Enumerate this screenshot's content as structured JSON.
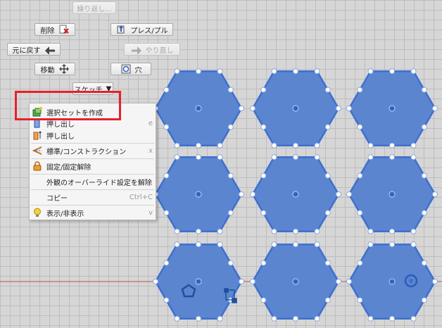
{
  "marking_menu": {
    "repeat": "繰り返し...",
    "delete": "削除",
    "press_pull": "プレス/プル",
    "undo": "元に戻す",
    "redo": "やり直し",
    "move": "移動",
    "hole": "穴",
    "sketch": "スケッチ"
  },
  "context_menu": {
    "items": [
      {
        "label": "選択セットを作成",
        "shortcut": "",
        "icon": "selection-set-icon"
      },
      {
        "label": "押し出し",
        "shortcut": "e",
        "icon": "extrude-icon"
      },
      {
        "label": "押し出し",
        "shortcut": "",
        "icon": "extrude-icon"
      },
      {
        "label": "標準/コンストラクション",
        "shortcut": "x",
        "icon": "construction-icon"
      },
      {
        "label": "固定/固定解除",
        "shortcut": "",
        "icon": "lock-icon"
      },
      {
        "label": "外観のオーバーライド設定を解除",
        "shortcut": "",
        "icon": ""
      },
      {
        "label": "コピー",
        "shortcut": "Ctrl+C",
        "icon": ""
      },
      {
        "label": "表示/非表示",
        "shortcut": "v",
        "icon": "lightbulb-icon"
      }
    ]
  },
  "colors": {
    "hexagon_fill": "#5b86cf",
    "hexagon_stroke": "#3f6fcf",
    "highlight": "#e8202a",
    "axis_red": "#c05050"
  }
}
